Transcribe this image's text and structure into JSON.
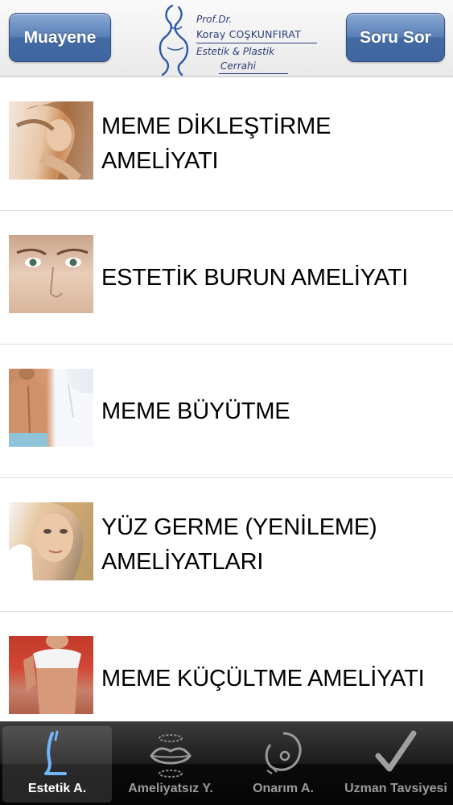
{
  "header": {
    "left_button": "Muayene",
    "right_button": "Soru Sor",
    "logo": {
      "line1": "Prof.Dr.",
      "line2": "Koray COŞKUNFIRAT",
      "line3": "Estetik & Plastik",
      "line4": "Cerrahi"
    }
  },
  "list": {
    "items": [
      {
        "title": "MEME DİKLEŞTİRME AMELİYATI",
        "image": "woman-hair-photo"
      },
      {
        "title": "ESTETİK BURUN AMELİYATI",
        "image": "woman-face-photo"
      },
      {
        "title": "MEME BÜYÜTME",
        "image": "doctor-patient-photo"
      },
      {
        "title": "YÜZ GERME (YENİLEME) AMELİYATLARI",
        "image": "face-lift-photo"
      },
      {
        "title": "MEME KÜÇÜLTME AMELİYATI",
        "image": "woman-torso-photo"
      }
    ]
  },
  "tabbar": {
    "active": "Estetik A.",
    "tabs": [
      {
        "label": "Estetik A.",
        "icon": "body-contour-icon"
      },
      {
        "label": "Ameliyatsız Y.",
        "icon": "lips-icon"
      },
      {
        "label": "Onarım A.",
        "icon": "suture-needle-icon"
      },
      {
        "label": "Uzman Tavsiyesi",
        "icon": "checkmark-icon"
      }
    ]
  },
  "colors": {
    "button_blue": "#4a70a8",
    "logo_navy": "#2e3f7a",
    "tabbar_bg": "#111111",
    "accent_icon_blue": "#6fb6ff"
  }
}
